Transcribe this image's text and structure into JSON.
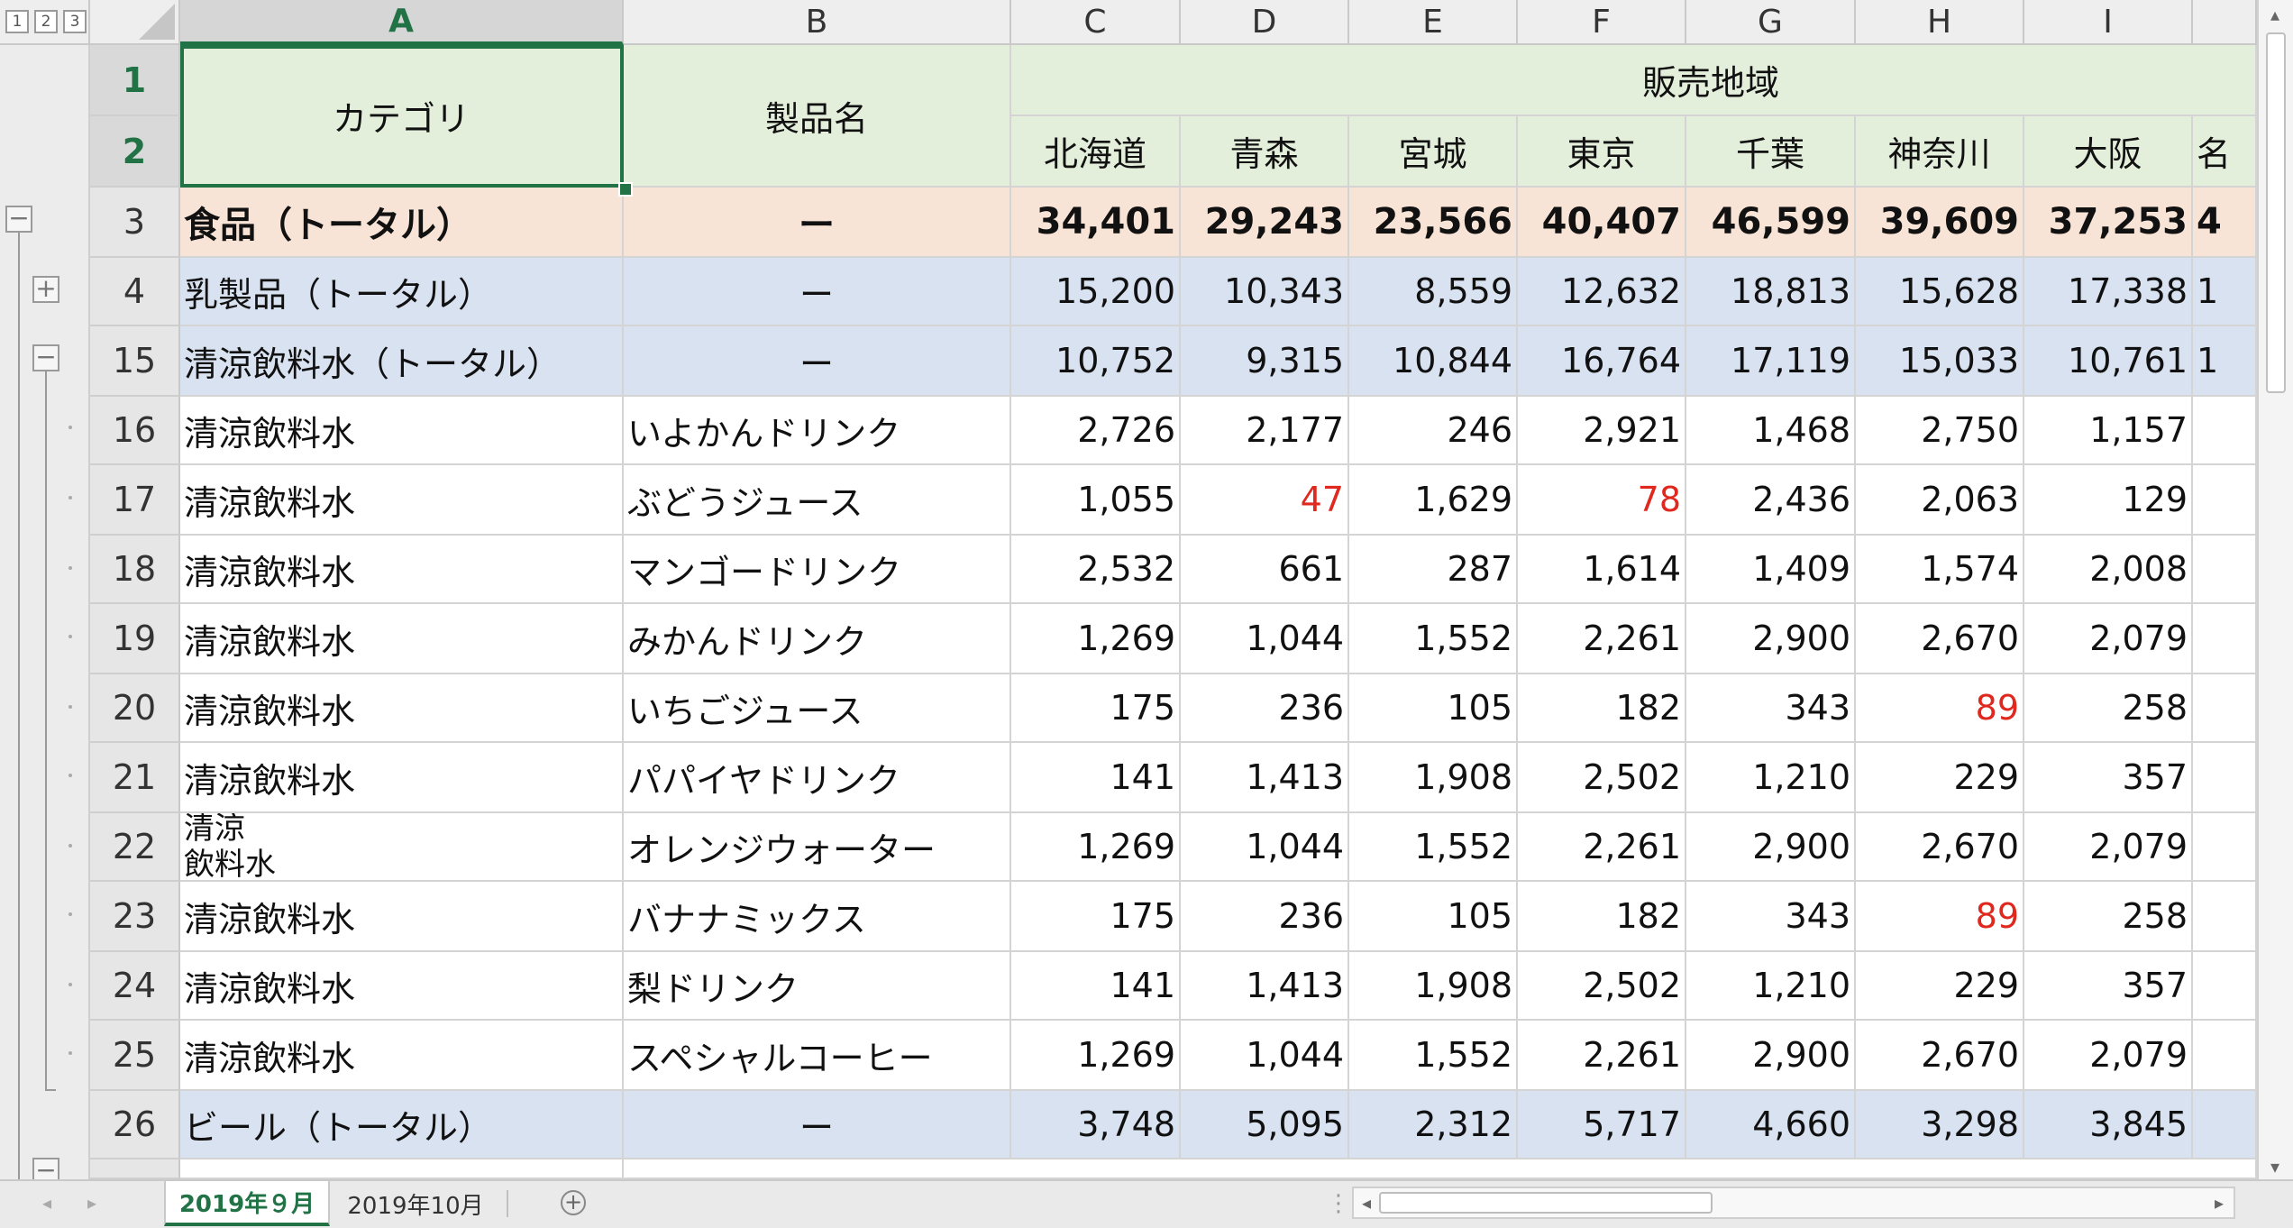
{
  "outline_levels": [
    "1",
    "2",
    "3"
  ],
  "columns": [
    "A",
    "B",
    "C",
    "D",
    "E",
    "F",
    "G",
    "H",
    "I"
  ],
  "header": {
    "category": "カテゴリ",
    "product": "製品名",
    "region_group": "販売地域",
    "regions": [
      "北海道",
      "青森",
      "宮城",
      "東京",
      "千葉",
      "神奈川",
      "大阪",
      "名"
    ]
  },
  "row_numbers_header": [
    "1",
    "2"
  ],
  "rows": [
    {
      "num": "3",
      "type": "food",
      "category": "食品（トータル）",
      "product": "ー",
      "values": [
        "34,401",
        "29,243",
        "23,566",
        "40,407",
        "46,599",
        "39,609",
        "37,253",
        "4"
      ]
    },
    {
      "num": "4",
      "type": "sub",
      "category": "乳製品（トータル）",
      "product": "ー",
      "values": [
        "15,200",
        "10,343",
        "8,559",
        "12,632",
        "18,813",
        "15,628",
        "17,338",
        "1"
      ]
    },
    {
      "num": "15",
      "type": "sub",
      "category": "清涼飲料水（トータル）",
      "product": "ー",
      "values": [
        "10,752",
        "9,315",
        "10,844",
        "16,764",
        "17,119",
        "15,033",
        "10,761",
        "1"
      ]
    },
    {
      "num": "16",
      "type": "white",
      "category": "清涼飲料水",
      "product": "いよかんドリンク",
      "values": [
        "2,726",
        "2,177",
        "246",
        "2,921",
        "1,468",
        "2,750",
        "1,157",
        ""
      ]
    },
    {
      "num": "17",
      "type": "white",
      "category": "清涼飲料水",
      "product": "ぶどうジュース",
      "values": [
        "1,055",
        "47",
        "1,629",
        "78",
        "2,436",
        "2,063",
        "129",
        ""
      ]
    },
    {
      "num": "18",
      "type": "white",
      "category": "清涼飲料水",
      "product": "マンゴードリンク",
      "values": [
        "2,532",
        "661",
        "287",
        "1,614",
        "1,409",
        "1,574",
        "2,008",
        ""
      ]
    },
    {
      "num": "19",
      "type": "white",
      "category": "清涼飲料水",
      "product": "みかんドリンク",
      "values": [
        "1,269",
        "1,044",
        "1,552",
        "2,261",
        "2,900",
        "2,670",
        "2,079",
        ""
      ]
    },
    {
      "num": "20",
      "type": "white",
      "category": "清涼飲料水",
      "product": "いちごジュース",
      "values": [
        "175",
        "236",
        "105",
        "182",
        "343",
        "89",
        "258",
        ""
      ]
    },
    {
      "num": "21",
      "type": "white",
      "category": "清涼飲料水",
      "product": "パパイヤドリンク",
      "values": [
        "141",
        "1,413",
        "1,908",
        "2,502",
        "1,210",
        "229",
        "357",
        ""
      ]
    },
    {
      "num": "22",
      "type": "white",
      "category": "清涼\n飲料水",
      "product": "オレンジウォーター",
      "values": [
        "1,269",
        "1,044",
        "1,552",
        "2,261",
        "2,900",
        "2,670",
        "2,079",
        ""
      ]
    },
    {
      "num": "23",
      "type": "white",
      "category": "清涼飲料水",
      "product": "バナナミックス",
      "values": [
        "175",
        "236",
        "105",
        "182",
        "343",
        "89",
        "258",
        ""
      ]
    },
    {
      "num": "24",
      "type": "white",
      "category": "清涼飲料水",
      "product": "梨ドリンク",
      "values": [
        "141",
        "1,413",
        "1,908",
        "2,502",
        "1,210",
        "229",
        "357",
        ""
      ]
    },
    {
      "num": "25",
      "type": "white",
      "category": "清涼飲料水",
      "product": "スペシャルコーヒー",
      "values": [
        "1,269",
        "1,044",
        "1,552",
        "2,261",
        "2,900",
        "2,670",
        "2,079",
        ""
      ]
    },
    {
      "num": "26",
      "type": "sub",
      "category": "ビール（トータル）",
      "product": "ー",
      "values": [
        "3,748",
        "5,095",
        "2,312",
        "5,717",
        "4,660",
        "3,298",
        "3,845",
        ""
      ]
    }
  ],
  "red_cells": [
    [
      4,
      1
    ],
    [
      4,
      3
    ],
    [
      7,
      5
    ],
    [
      10,
      5
    ]
  ],
  "sheet_tabs": [
    "2019年９月",
    "2019年10月"
  ],
  "colors": {
    "accent": "#217346",
    "header_fill": "#e3eedb",
    "food_fill": "#f8e4d6",
    "subtotal_fill": "#d9e2f0",
    "negative_red": "#e0281e"
  }
}
